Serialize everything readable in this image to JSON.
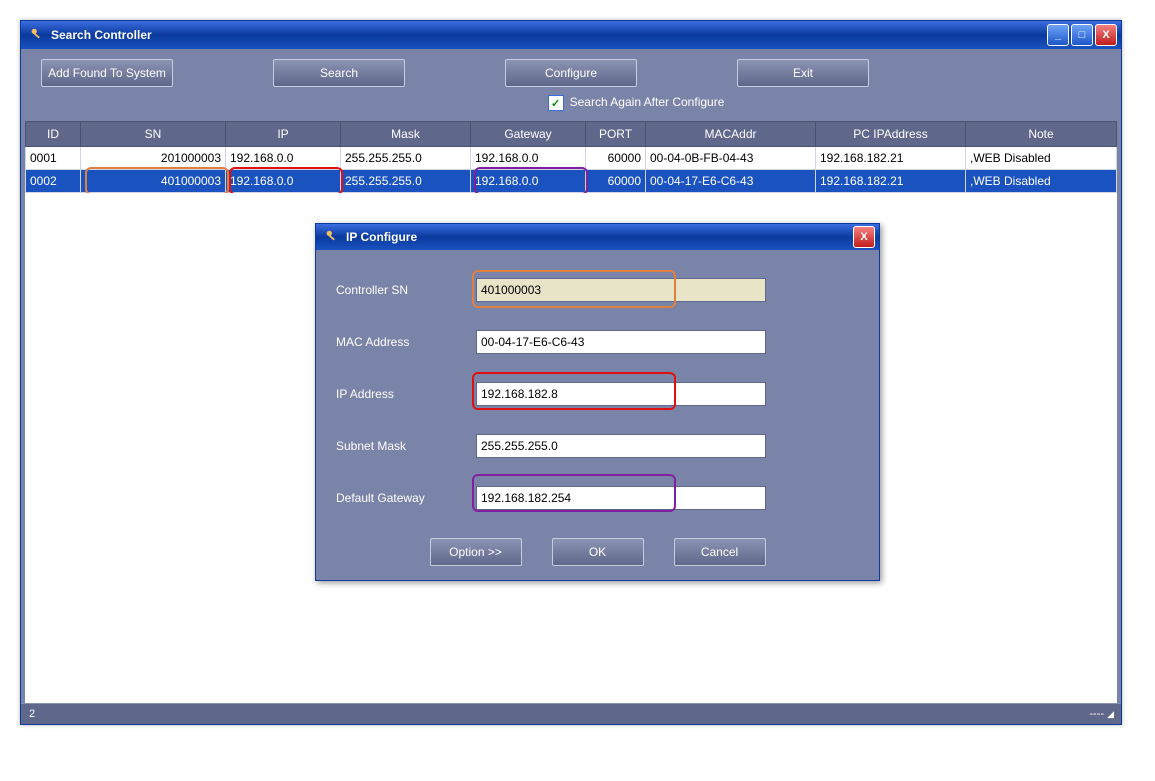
{
  "window": {
    "title": "Search Controller",
    "minimize": "_",
    "maximize": "□",
    "close": "X"
  },
  "toolbar": {
    "add_found": "Add Found To System",
    "search": "Search",
    "configure": "Configure",
    "exit": "Exit"
  },
  "checkbox": {
    "label": "Search Again After Configure",
    "checked": "✓"
  },
  "columns": {
    "id": "ID",
    "sn": "SN",
    "ip": "IP",
    "mask": "Mask",
    "gateway": "Gateway",
    "port": "PORT",
    "mac": "MACAddr",
    "pcip": "PC IPAddress",
    "note": "Note"
  },
  "rows": [
    {
      "id": "0001",
      "sn": "201000003",
      "ip": "192.168.0.0",
      "mask": "255.255.255.0",
      "gateway": "192.168.0.0",
      "port": "60000",
      "mac": "00-04-0B-FB-04-43",
      "pcip": "192.168.182.21",
      "note": ",WEB Disabled"
    },
    {
      "id": "0002",
      "sn": "401000003",
      "ip": "192.168.0.0",
      "mask": "255.255.255.0",
      "gateway": "192.168.0.0",
      "port": "60000",
      "mac": "00-04-17-E6-C6-43",
      "pcip": "192.168.182.21",
      "note": ",WEB Disabled"
    }
  ],
  "status": {
    "left": "2",
    "right": "----"
  },
  "dialog": {
    "title": "IP Configure",
    "close": "X",
    "labels": {
      "sn": "Controller SN",
      "mac": "MAC Address",
      "ip": "IP Address",
      "mask": "Subnet Mask",
      "gateway": "Default Gateway"
    },
    "values": {
      "sn": "401000003",
      "mac": "00-04-17-E6-C6-43",
      "ip": "192.168.182.8",
      "mask": "255.255.255.0",
      "gateway": "192.168.182.254"
    },
    "buttons": {
      "option": "Option >>",
      "ok": "OK",
      "cancel": "Cancel"
    }
  },
  "highlight_colors": {
    "orange": "#e08040",
    "red": "#e01010",
    "purple": "#8020a0"
  }
}
